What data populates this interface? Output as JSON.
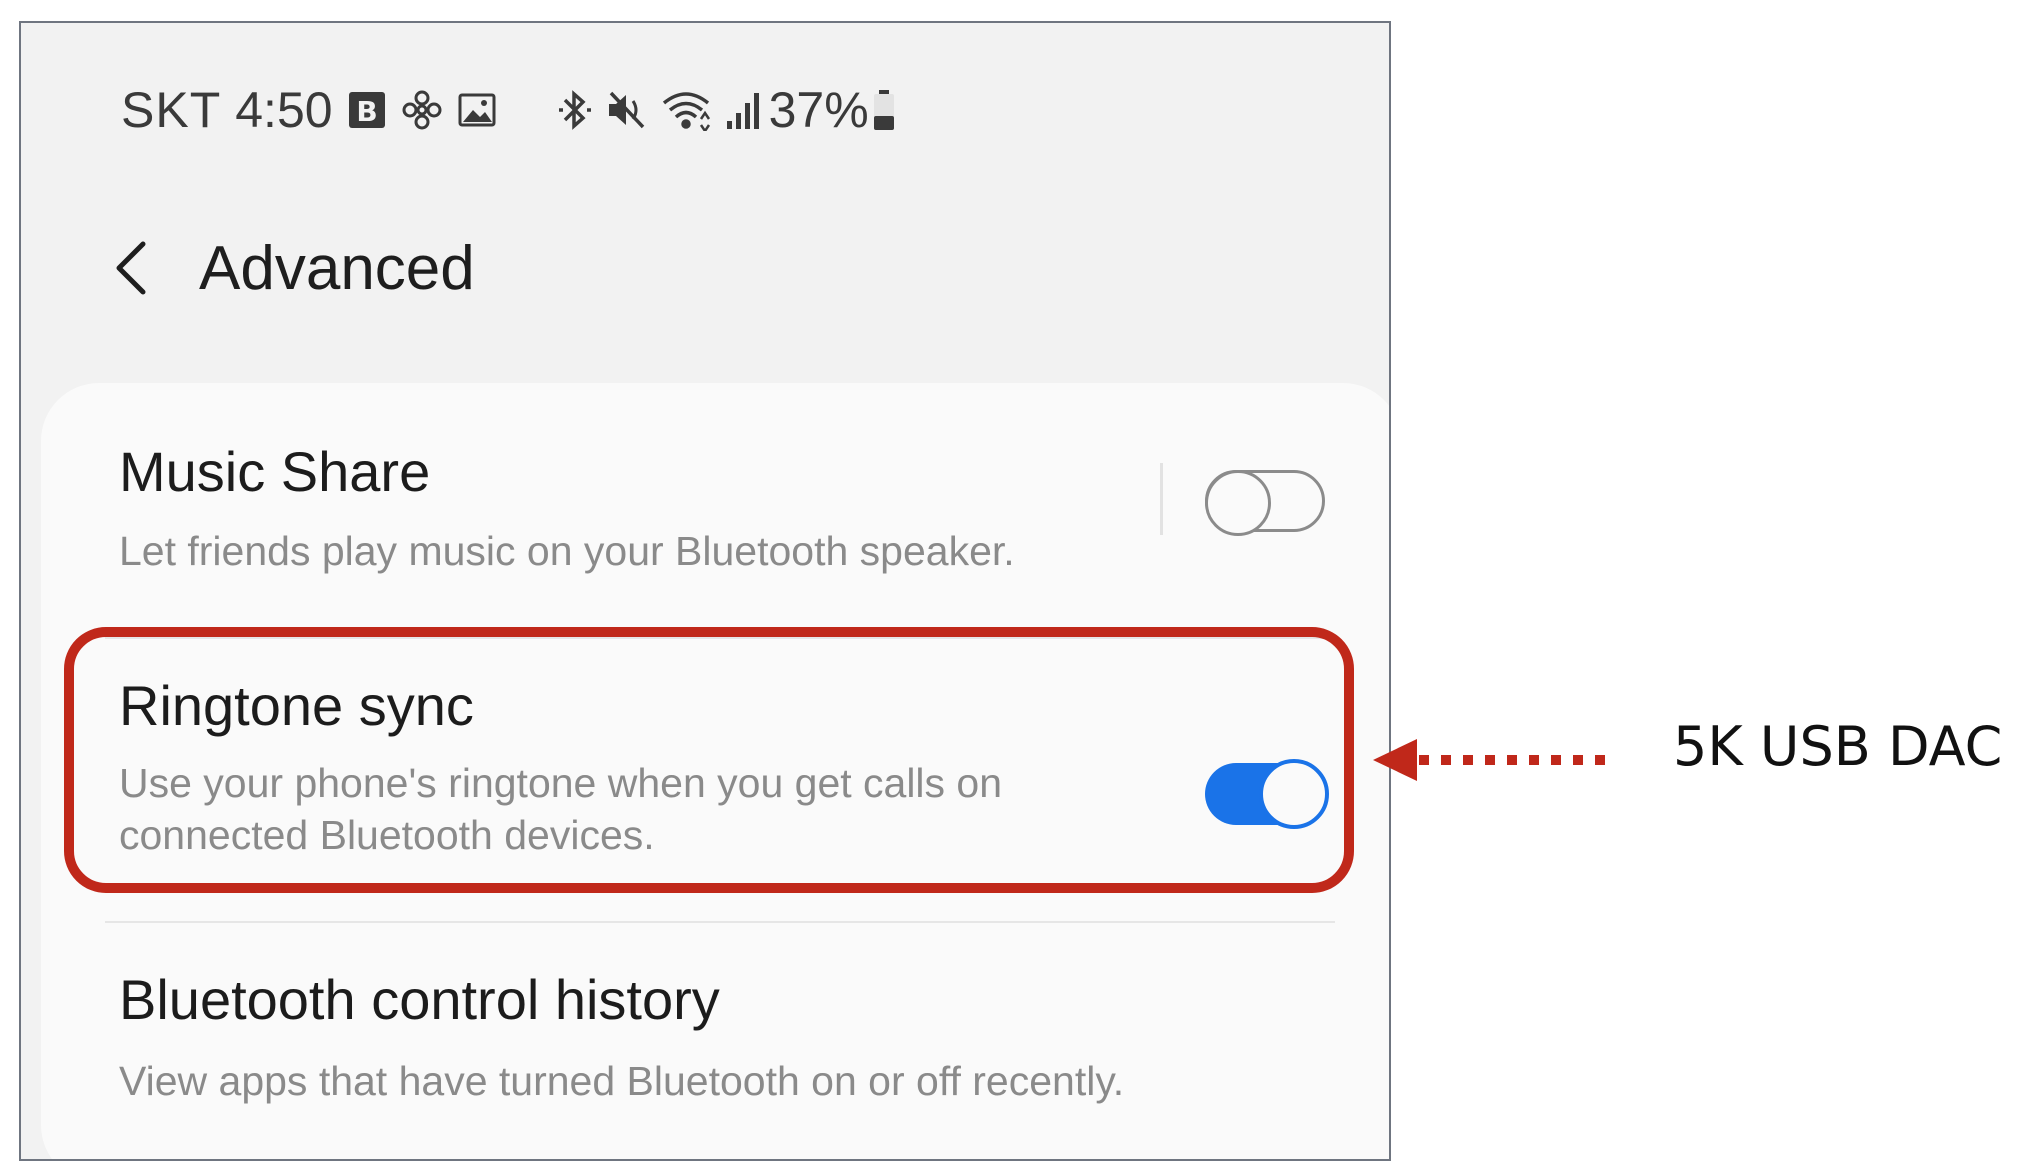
{
  "status_bar": {
    "carrier": "SKT",
    "time": "4:50",
    "left_icons": [
      "b-badge-icon",
      "flower-icon",
      "image-icon"
    ],
    "right_icons": [
      "bluetooth-icon",
      "mute-icon",
      "wifi-icon",
      "signal-icon"
    ],
    "battery_percent": "37%"
  },
  "header": {
    "back_icon": "chevron-left-icon",
    "title": "Advanced"
  },
  "settings": [
    {
      "title": "Music Share",
      "description": "Let friends play music on your Bluetooth speaker.",
      "toggle": "off"
    },
    {
      "title": "Ringtone sync",
      "description_line1": "Use your phone's ringtone when you get calls on",
      "description_line2": "connected Bluetooth devices.",
      "toggle": "on"
    },
    {
      "title": "Bluetooth control history",
      "description": "View apps that have turned Bluetooth on or off recently."
    }
  ],
  "annotation": {
    "label": "5K USB DAC",
    "color": "#c0281a"
  },
  "colors": {
    "toggle_on": "#1a73e8",
    "background": "#f2f2f2",
    "card": "#fafafa"
  }
}
